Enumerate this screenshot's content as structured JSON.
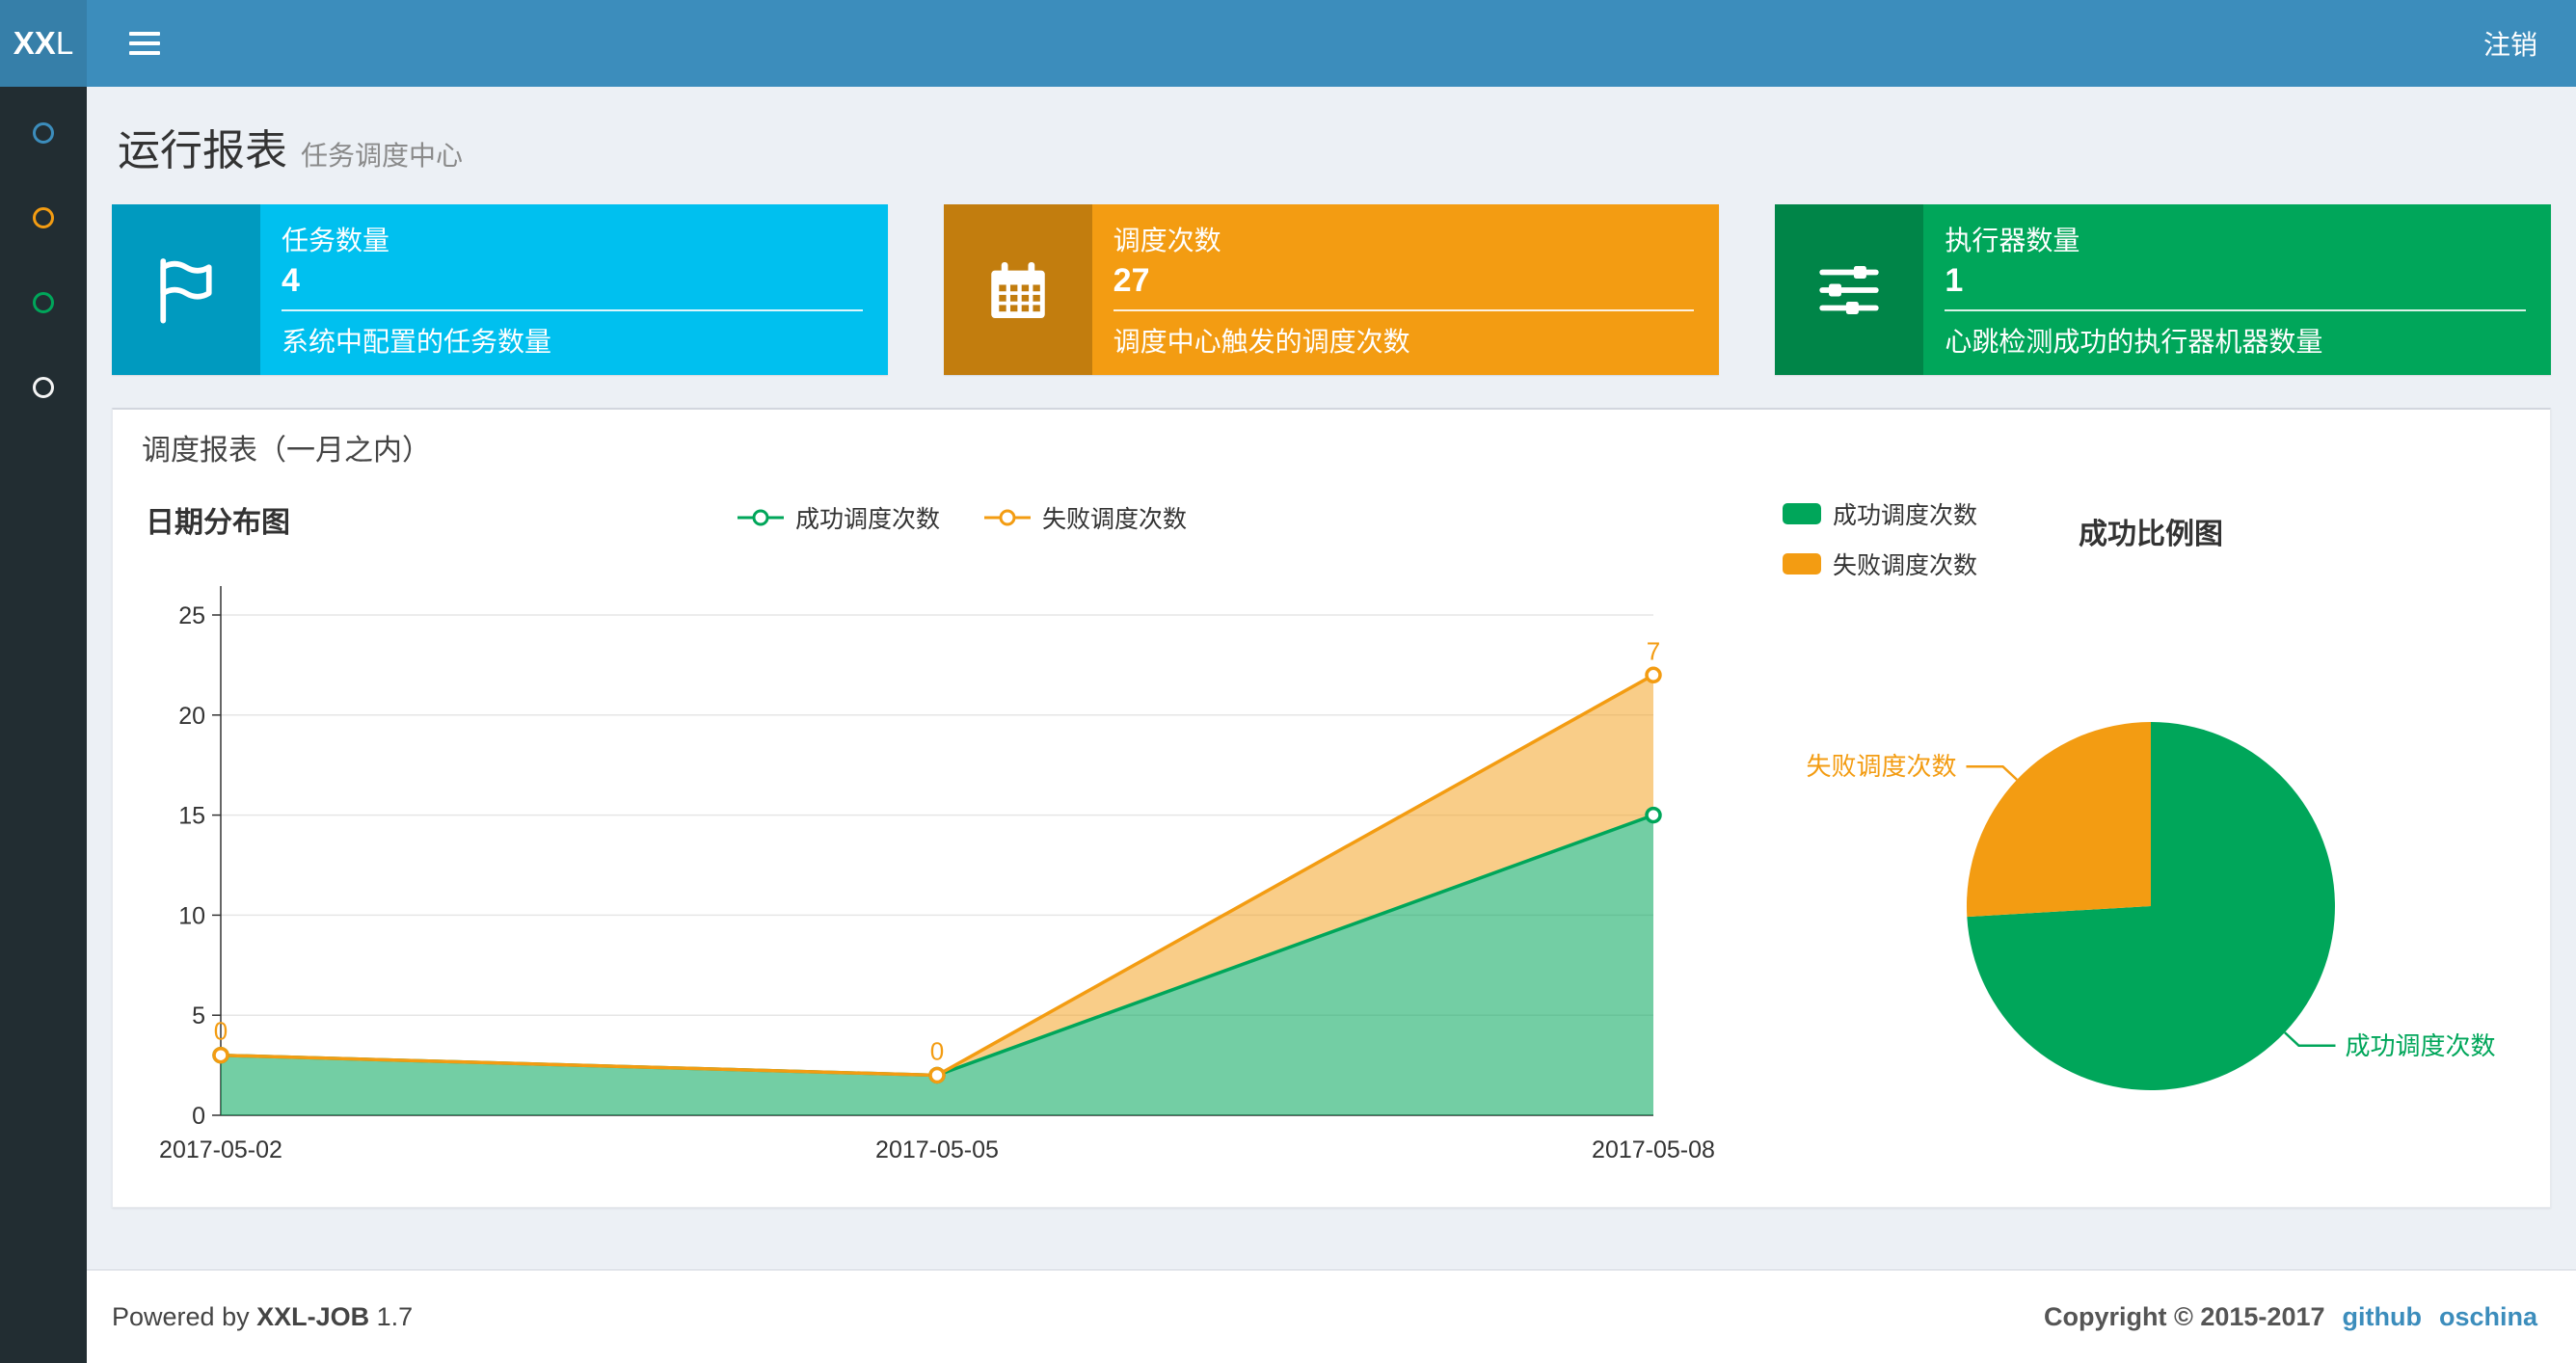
{
  "navbar": {
    "logo_bold": "XX",
    "logo_light": "L",
    "logout": "注销"
  },
  "sidebar": {
    "items": [
      {
        "name": "menu-1",
        "color": "#3c8dbc"
      },
      {
        "name": "menu-2",
        "color": "#f39c12"
      },
      {
        "name": "menu-3",
        "color": "#00a65a"
      },
      {
        "name": "menu-4",
        "color": "#f4f4f4"
      }
    ]
  },
  "page_header": {
    "title": "运行报表",
    "subtitle": "任务调度中心"
  },
  "info_boxes": [
    {
      "title": "任务数量",
      "value": "4",
      "desc": "系统中配置的任务数量",
      "color": "#00c0ef",
      "icon_bg": "#009abf",
      "icon": "flag-icon"
    },
    {
      "title": "调度次数",
      "value": "27",
      "desc": "调度中心触发的调度次数",
      "color": "#f39c12",
      "icon_bg": "#c27d0e",
      "icon": "calendar-icon"
    },
    {
      "title": "执行器数量",
      "value": "1",
      "desc": "心跳检测成功的执行器机器数量",
      "color": "#00a65a",
      "icon_bg": "#008548",
      "icon": "sliders-icon"
    }
  ],
  "panel": {
    "title": "调度报表（一月之内）"
  },
  "chart_data": [
    {
      "type": "area",
      "title": "日期分布图",
      "stacked": true,
      "categories": [
        "2017-05-02",
        "2017-05-05",
        "2017-05-08"
      ],
      "series": [
        {
          "name": "成功调度次数",
          "color": "#00a65a",
          "values": [
            3,
            2,
            15
          ]
        },
        {
          "name": "失败调度次数",
          "color": "#f39c12",
          "values": [
            0,
            0,
            7
          ]
        }
      ],
      "data_labels": {
        "series": "失败调度次数",
        "values": [
          0,
          0,
          7
        ]
      },
      "ylim": [
        0,
        25
      ],
      "yticks": [
        0,
        5,
        10,
        15,
        20,
        25
      ],
      "grid": true,
      "legend_position": "top-center"
    },
    {
      "type": "pie",
      "title": "成功比例图",
      "slices": [
        {
          "name": "成功调度次数",
          "value": 20,
          "color": "#00a65a"
        },
        {
          "name": "失败调度次数",
          "value": 7,
          "color": "#f39c12"
        }
      ],
      "legend_position": "top-left"
    }
  ],
  "footer": {
    "powered_prefix": "Powered by",
    "brand": "XXL-JOB",
    "version": "1.7",
    "copyright": "Copyright © 2015-2017",
    "links": [
      "github",
      "oschina"
    ]
  }
}
